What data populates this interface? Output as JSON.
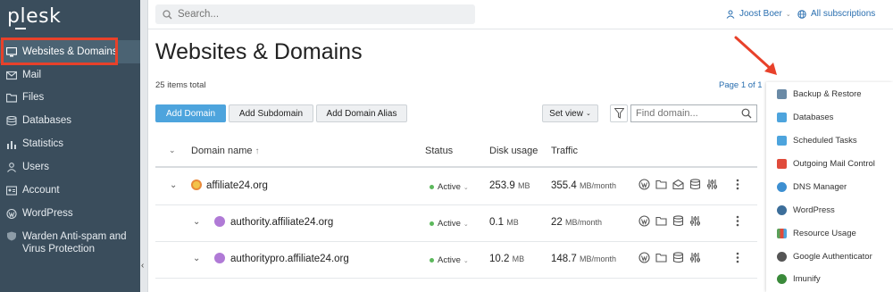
{
  "app": {
    "logo": "plesk"
  },
  "sidebar": {
    "items": [
      {
        "label": "Websites & Domains"
      },
      {
        "label": "Mail"
      },
      {
        "label": "Files"
      },
      {
        "label": "Databases"
      },
      {
        "label": "Statistics"
      },
      {
        "label": "Users"
      },
      {
        "label": "Account"
      },
      {
        "label": "WordPress"
      },
      {
        "label": "Warden Anti-spam and"
      },
      {
        "label": "Virus Protection"
      }
    ]
  },
  "topbar": {
    "search_placeholder": "Search...",
    "user": "Joost Boer",
    "subscriptions": "All subscriptions"
  },
  "main": {
    "title": "Websites & Domains",
    "items_total": "25 items total",
    "page_of": "Page 1 of 1",
    "buttons": {
      "add_domain": "Add Domain",
      "add_subdomain": "Add Subdomain",
      "add_alias": "Add Domain Alias",
      "set_view": "Set view"
    },
    "find_placeholder": "Find domain..."
  },
  "table": {
    "headers": {
      "domain": "Domain name",
      "sort_arrow": "↑",
      "status": "Status",
      "disk": "Disk usage",
      "traffic": "Traffic"
    },
    "rows": [
      {
        "domain": "affiliate24.org",
        "status": "Active",
        "disk": "253.9",
        "disk_unit": "MB",
        "traffic": "355.4",
        "traffic_unit": "MB/month"
      },
      {
        "domain": "authority.affiliate24.org",
        "status": "Active",
        "disk": "0.1",
        "disk_unit": "MB",
        "traffic": "22",
        "traffic_unit": "MB/month"
      },
      {
        "domain": "authoritypro.affiliate24.org",
        "status": "Active",
        "disk": "10.2",
        "disk_unit": "MB",
        "traffic": "148.7",
        "traffic_unit": "MB/month"
      }
    ]
  },
  "right_panel": {
    "items": [
      {
        "label": "Backup & Restore",
        "color": "#6a8aa6"
      },
      {
        "label": "Databases",
        "color": "#4da4dd"
      },
      {
        "label": "Scheduled Tasks",
        "color": "#4da4dd"
      },
      {
        "label": "Outgoing Mail Control",
        "color": "#e04b3b"
      },
      {
        "label": "DNS Manager",
        "color": "#3d8fd1"
      },
      {
        "label": "WordPress",
        "color": "#3c6e9a"
      },
      {
        "label": "Resource Usage",
        "color": "#5aa05a"
      },
      {
        "label": "Google Authenticator",
        "color": "#555555"
      },
      {
        "label": "Imunify",
        "color": "#3a8a3a"
      }
    ]
  },
  "colors": {
    "sidebar_bg": "#3a4d5c",
    "highlight": "#e8412a",
    "primary": "#4da4dd",
    "link": "#2a6fb0",
    "active_dot": "#5cb85c"
  }
}
